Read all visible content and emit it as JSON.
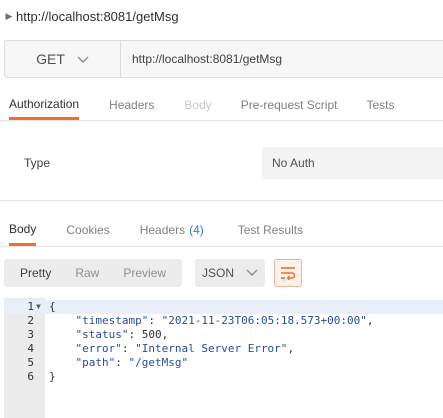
{
  "request": {
    "title": "http://localhost:8081/getMsg",
    "method": "GET",
    "url": "http://localhost:8081/getMsg"
  },
  "request_tabs": [
    {
      "label": "Authorization",
      "state": "active"
    },
    {
      "label": "Headers",
      "state": "normal"
    },
    {
      "label": "Body",
      "state": "disabled"
    },
    {
      "label": "Pre-request Script",
      "state": "normal"
    },
    {
      "label": "Tests",
      "state": "normal"
    }
  ],
  "auth": {
    "type_label": "Type",
    "type_value": "No Auth"
  },
  "response_tabs": {
    "body": "Body",
    "cookies": "Cookies",
    "headers": "Headers",
    "headers_count": "(4)",
    "test_results": "Test Results"
  },
  "toolbar": {
    "pretty": "Pretty",
    "raw": "Raw",
    "preview": "Preview",
    "format": "JSON"
  },
  "response_lines": [
    {
      "num": "1",
      "text": "{"
    },
    {
      "num": "2",
      "key": "\"timestamp\"",
      "value": "\"2021-11-23T06:05:18.573+00:00\"",
      "tail": ","
    },
    {
      "num": "3",
      "key": "\"status\"",
      "value": "500",
      "tail": ","
    },
    {
      "num": "4",
      "key": "\"error\"",
      "value": "\"Internal Server Error\"",
      "tail": ","
    },
    {
      "num": "5",
      "key": "\"path\"",
      "value": "\"/getMsg\"",
      "tail": ""
    },
    {
      "num": "6",
      "text": "}"
    }
  ],
  "colors": {
    "accent": "#f26b3a",
    "count_blue": "#3a7bd5",
    "json_string": "#2a4aa0"
  }
}
